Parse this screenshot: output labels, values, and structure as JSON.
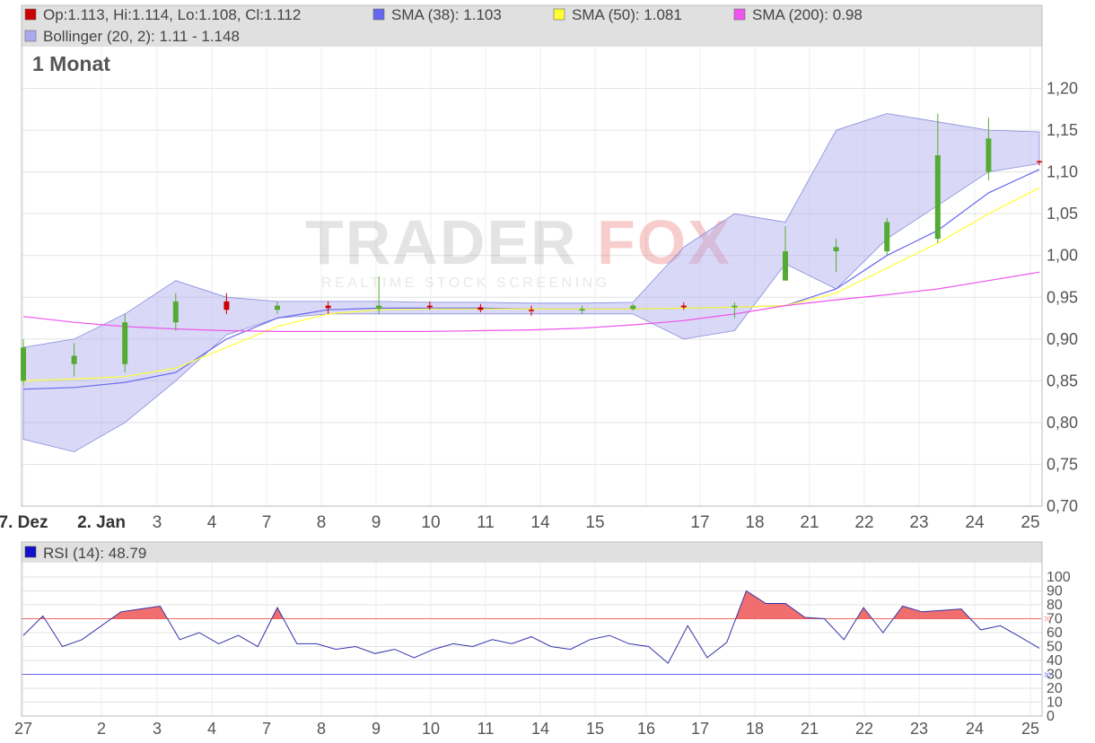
{
  "legend_main": {
    "ohlc": "Op:1.113, Hi:1.114, Lo:1.108, Cl:1.112",
    "sma38": "SMA (38): 1.103",
    "sma50": "SMA (50): 1.081",
    "sma200": "SMA (200): 0.98",
    "bollinger": "Bollinger (20, 2): 1.11 - 1.148"
  },
  "legend_rsi": {
    "rsi": "RSI (14): 48.79"
  },
  "period_label": "1 Monat",
  "watermark": {
    "brand_left": "TRADER",
    "brand_right": "FOX",
    "tagline": "REALTIME STOCK SCREENING"
  },
  "colors": {
    "ohlc": "#cc0000",
    "sma38": "#6666ee",
    "sma50": "#ffff33",
    "sma200": "#ee55ee",
    "bollinger": "#aaaaee",
    "up": "#55aa33",
    "down": "#cc0000",
    "rsi": "#3333aa",
    "rsi_hot": "#ee5555",
    "legend_bg": "#e0e0e0"
  },
  "chart_data": [
    {
      "type": "candlestick",
      "title": "1 Monat",
      "x_tick_labels": [
        "7. Dez",
        "2. Jan",
        "3",
        "4",
        "7",
        "8",
        "9",
        "10",
        "11",
        "14",
        "15",
        "17",
        "18",
        "21",
        "22",
        "23",
        "24",
        "25"
      ],
      "y_ticks": [
        "0,70",
        "0,75",
        "0,80",
        "0,85",
        "0,90",
        "0,95",
        "1,00",
        "1,05",
        "1,10",
        "1,15",
        "1,20"
      ],
      "ylim": [
        0.7,
        1.25
      ],
      "grid": true,
      "series": [
        {
          "name": "SMA (38)",
          "values": [
            0.84,
            0.842,
            0.848,
            0.86,
            0.9,
            0.925,
            0.935,
            0.937,
            0.937,
            0.937,
            0.936,
            0.936,
            0.936,
            0.937,
            0.938,
            0.94,
            0.96,
            1.0,
            1.03,
            1.075,
            1.103
          ]
        },
        {
          "name": "SMA (50)",
          "values": [
            0.85,
            0.852,
            0.855,
            0.865,
            0.89,
            0.915,
            0.93,
            0.935,
            0.936,
            0.936,
            0.936,
            0.936,
            0.936,
            0.937,
            0.938,
            0.94,
            0.955,
            0.985,
            1.015,
            1.05,
            1.081
          ]
        },
        {
          "name": "SMA (200)",
          "values": [
            0.927,
            0.92,
            0.915,
            0.912,
            0.91,
            0.909,
            0.909,
            0.909,
            0.909,
            0.91,
            0.911,
            0.913,
            0.917,
            0.922,
            0.93,
            0.94,
            0.947,
            0.953,
            0.96,
            0.97,
            0.98
          ]
        },
        {
          "name": "Bollinger (20, 2) upper",
          "values": [
            0.89,
            0.9,
            0.93,
            0.97,
            0.95,
            0.945,
            0.945,
            0.945,
            0.944,
            0.944,
            0.943,
            0.943,
            0.944,
            1.01,
            1.05,
            1.04,
            1.15,
            1.17,
            1.16,
            1.15,
            1.148
          ]
        },
        {
          "name": "Bollinger (20, 2) lower",
          "values": [
            0.78,
            0.765,
            0.8,
            0.85,
            0.905,
            0.925,
            0.93,
            0.93,
            0.93,
            0.93,
            0.93,
            0.93,
            0.93,
            0.9,
            0.91,
            0.99,
            0.96,
            1.02,
            1.06,
            1.1,
            1.11
          ]
        },
        {
          "name": "Candles",
          "ohlc": [
            [
              0.85,
              0.9,
              0.845,
              0.89
            ],
            [
              0.87,
              0.895,
              0.855,
              0.88
            ],
            [
              0.87,
              0.93,
              0.86,
              0.92
            ],
            [
              0.92,
              0.955,
              0.91,
              0.945
            ],
            [
              0.945,
              0.955,
              0.93,
              0.935
            ],
            [
              0.935,
              0.945,
              0.93,
              0.94
            ],
            [
              0.94,
              0.945,
              0.93,
              0.937
            ],
            [
              0.936,
              0.975,
              0.93,
              0.94
            ],
            [
              0.94,
              0.945,
              0.935,
              0.938
            ],
            [
              0.938,
              0.942,
              0.932,
              0.935
            ],
            [
              0.935,
              0.94,
              0.928,
              0.934
            ],
            [
              0.934,
              0.94,
              0.93,
              0.936
            ],
            [
              0.936,
              0.942,
              0.934,
              0.94
            ],
            [
              0.94,
              0.944,
              0.935,
              0.938
            ],
            [
              0.938,
              0.944,
              0.925,
              0.94
            ],
            [
              0.97,
              1.035,
              0.97,
              1.005
            ],
            [
              1.005,
              1.02,
              0.98,
              1.01
            ],
            [
              1.005,
              1.045,
              1.0,
              1.04
            ],
            [
              1.02,
              1.17,
              1.015,
              1.12
            ],
            [
              1.1,
              1.165,
              1.09,
              1.14
            ],
            [
              1.113,
              1.114,
              1.108,
              1.112
            ]
          ]
        }
      ]
    },
    {
      "type": "line",
      "title": "RSI (14)",
      "x_tick_labels": [
        "27",
        "2",
        "3",
        "4",
        "7",
        "8",
        "9",
        "10",
        "11",
        "14",
        "15",
        "16",
        "17",
        "18",
        "21",
        "22",
        "23",
        "24",
        "25"
      ],
      "y_ticks": [
        "0",
        "10",
        "20",
        "30",
        "40",
        "50",
        "60",
        "70",
        "80",
        "90",
        "100"
      ],
      "ylim": [
        0,
        100
      ],
      "reference_lines": [
        70,
        30
      ],
      "series": [
        {
          "name": "RSI (14)",
          "values": [
            58,
            72,
            50,
            55,
            65,
            75,
            77,
            79,
            55,
            60,
            52,
            58,
            50,
            78,
            52,
            52,
            48,
            50,
            45,
            48,
            42,
            48,
            52,
            50,
            55,
            52,
            57,
            50,
            48,
            55,
            58,
            52,
            50,
            38,
            65,
            42,
            53,
            90,
            81,
            81,
            71,
            70,
            55,
            78,
            60,
            79,
            75,
            76,
            77,
            62,
            65,
            57,
            48.79
          ]
        }
      ]
    }
  ]
}
